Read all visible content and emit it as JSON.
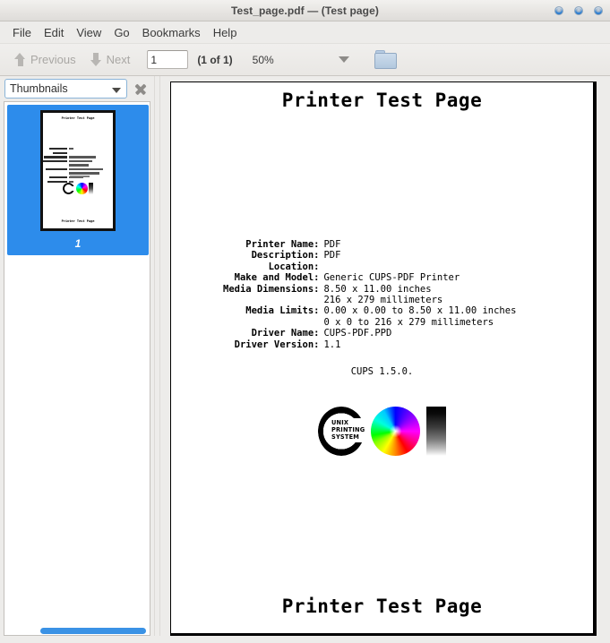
{
  "window": {
    "title": "Test_page.pdf — (Test page)",
    "buttons": [
      "minimize-button",
      "maximize-button",
      "close-button"
    ]
  },
  "menubar": {
    "items": [
      {
        "label": "File"
      },
      {
        "label": "Edit"
      },
      {
        "label": "View"
      },
      {
        "label": "Go"
      },
      {
        "label": "Bookmarks"
      },
      {
        "label": "Help"
      }
    ]
  },
  "toolbar": {
    "previous_label": "Previous",
    "next_label": "Next",
    "page_value": "1",
    "page_placeholder": "1",
    "page_of": "(1 of 1)",
    "zoom_level": "50%",
    "folder_icon": "folder-icon"
  },
  "sidebar": {
    "selector_value": "Thumbnails",
    "close_icon": "close-icon",
    "thumbnails": [
      {
        "page_number": "1",
        "selected": true
      }
    ]
  },
  "document": {
    "header_title": "Printer Test Page",
    "footer_title": "Printer Test Page",
    "info_rows": [
      {
        "label": "Printer Name:",
        "value": "PDF"
      },
      {
        "label": "Description:",
        "value": "PDF"
      },
      {
        "label": "Location:",
        "value": ""
      },
      {
        "label": "Make and Model:",
        "value": "Generic CUPS-PDF Printer"
      },
      {
        "label": "Media Dimensions:",
        "value": "8.50 x 11.00 inches"
      },
      {
        "label": "",
        "value": "216 x 279 millimeters"
      },
      {
        "label": "Media Limits:",
        "value": "0.00 x 0.00 to 8.50 x 11.00 inches"
      },
      {
        "label": "",
        "value": "0 x 0 to 216 x 279 millimeters"
      },
      {
        "label": "Driver Name:",
        "value": "CUPS-PDF.PPD"
      },
      {
        "label": "Driver Version:",
        "value": "1.1"
      }
    ],
    "cups_version": "CUPS 1.5.0.",
    "logo_text_lines": [
      "UNIX",
      "PRINTING",
      "SYSTEM"
    ]
  },
  "colors": {
    "selection_blue": "#2d8ceb",
    "scrollbar_blue": "#3a92e5",
    "titlebar_bg": "#e9e7e4",
    "chrome_bg": "#edecea",
    "paper_white": "#ffffff",
    "ink_black": "#000000"
  }
}
